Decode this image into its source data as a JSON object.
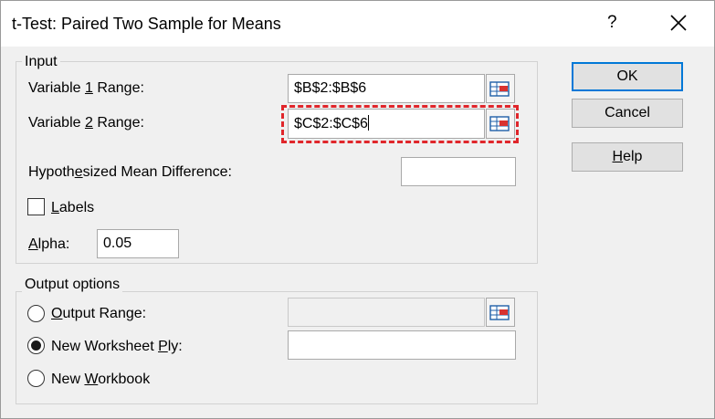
{
  "dialog": {
    "title": "t-Test: Paired Two Sample for Means",
    "help_glyph": "?",
    "close_icon": "close-icon"
  },
  "input": {
    "group_label": "Input",
    "var1_label_pre": "Variable ",
    "var1_label_key": "1",
    "var1_label_post": " Range:",
    "var1_value": "$B$2:$B$6",
    "var2_label_pre": "Variable ",
    "var2_label_key": "2",
    "var2_label_post": " Range:",
    "var2_value": "$C$2:$C$6",
    "hyp_label_pre": "Hypoth",
    "hyp_label_key": "e",
    "hyp_label_post": "sized Mean Difference:",
    "hyp_value": "",
    "labels_key": "L",
    "labels_rest": "abels",
    "labels_checked": false,
    "alpha_key": "A",
    "alpha_rest": "lpha:",
    "alpha_value": "0.05"
  },
  "output": {
    "group_label": "Output options",
    "output_range_key": "O",
    "output_range_rest": "utput Range:",
    "output_range_value": "",
    "new_ply_pre": "New Worksheet ",
    "new_ply_key": "P",
    "new_ply_post": "ly:",
    "new_ply_value": "",
    "new_workbook_pre": "New ",
    "new_workbook_key": "W",
    "new_workbook_post": "orkbook",
    "selected": "new_worksheet_ply"
  },
  "buttons": {
    "ok": "OK",
    "cancel": "Cancel",
    "help_key": "H",
    "help_rest": "elp"
  },
  "colors": {
    "highlight": "#e0262b",
    "default_button_border": "#0078d7"
  }
}
